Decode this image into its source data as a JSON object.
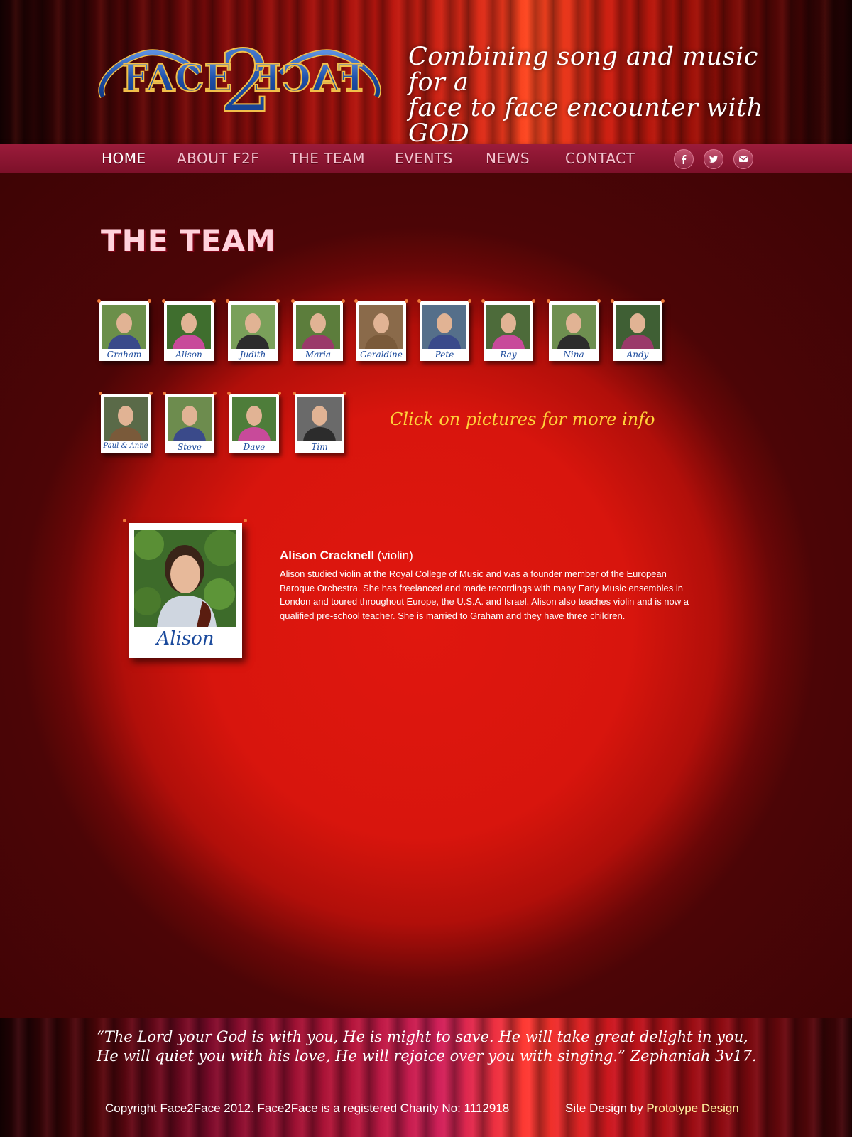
{
  "header": {
    "logo_left": "FACE",
    "logo_mid": "2",
    "logo_right": "FACE",
    "tagline_line1": "Combining song and music for a",
    "tagline_line2": "face to face encounter with GOD"
  },
  "nav": {
    "items": [
      {
        "label": "HOME",
        "active": true
      },
      {
        "label": "ABOUT F2F",
        "active": false
      },
      {
        "label": "THE TEAM",
        "active": false
      },
      {
        "label": "EVENTS",
        "active": false
      },
      {
        "label": "NEWS",
        "active": false
      },
      {
        "label": "CONTACT",
        "active": false
      }
    ],
    "social": [
      {
        "icon": "facebook-icon",
        "glyph": "f"
      },
      {
        "icon": "twitter-icon",
        "glyph": "t"
      },
      {
        "icon": "mail-icon",
        "glyph": "✉"
      }
    ]
  },
  "main": {
    "title": "THE TEAM",
    "team_row1": [
      "Graham",
      "Alison",
      "Judith",
      "Maria",
      "Geraldine",
      "Pete",
      "Ray",
      "Nina",
      "Andy"
    ],
    "team_row2": [
      "Paul & Anne",
      "Steve",
      "Dave",
      "Tim"
    ],
    "hint": "Click on pictures for more info",
    "selected": {
      "caption": "Alison",
      "name": "Alison Cracknell",
      "instrument": "(violin)",
      "bio": "Alison studied violin at the Royal College of Music and was a founder member of the European Baroque Orchestra. She has freelanced and made recordings with many Early Music ensembles in London and toured throughout Europe, the U.S.A. and Israel. Alison also teaches violin and is now a qualified pre-school teacher. She is married to Graham and they have three children."
    }
  },
  "footer": {
    "quote": "“The Lord your God is with you, He is might to save. He will take great delight in you, He will quiet you with his love, He will rejoice over you with singing.” Zephaniah 3v17.",
    "copyright": "Copyright Face2Face 2012. Face2Face is a registered Charity No: 1112918",
    "credit_prefix": "Site Design by",
    "credit_link": "Prototype Design"
  },
  "colors": {
    "accent_blue": "#1b4a9c",
    "nav_bar": "#8e1a36",
    "hint_yellow": "#ffd23a",
    "credit_link": "#fff3a0"
  }
}
